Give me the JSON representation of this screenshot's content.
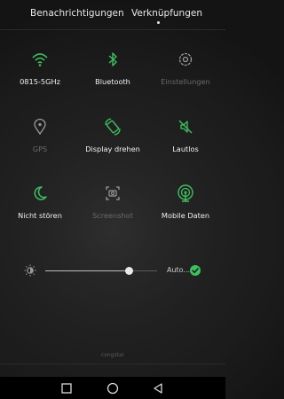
{
  "tabs": [
    {
      "label": "Benachrichtigungen",
      "active": false
    },
    {
      "label": "Verknüpfungen",
      "active": true
    }
  ],
  "toggles": [
    {
      "label": "0815-5GHz",
      "icon": "wifi-icon",
      "active": true
    },
    {
      "label": "Bluetooth",
      "icon": "bluetooth-icon",
      "active": true
    },
    {
      "label": "Einstellungen",
      "icon": "settings-icon",
      "active": false
    },
    {
      "label": "GPS",
      "icon": "location-icon",
      "active": false
    },
    {
      "label": "Display drehen",
      "icon": "rotate-screen-icon",
      "active": true
    },
    {
      "label": "Lautlos",
      "icon": "mute-icon",
      "active": true
    },
    {
      "label": "Nicht stören",
      "icon": "moon-icon",
      "active": true
    },
    {
      "label": "Screenshot",
      "icon": "screenshot-icon",
      "active": false
    },
    {
      "label": "Mobile Daten",
      "icon": "mobile-data-icon",
      "active": true
    }
  ],
  "brightness": {
    "level": 0.75,
    "auto_label": "Auto...",
    "auto_enabled": true
  },
  "carrier": "congstar",
  "colors": {
    "accent": "#3fbf5f",
    "inactive": "#6a6a6a",
    "label": "#f0f0f0",
    "background": "#1b1b1b"
  }
}
